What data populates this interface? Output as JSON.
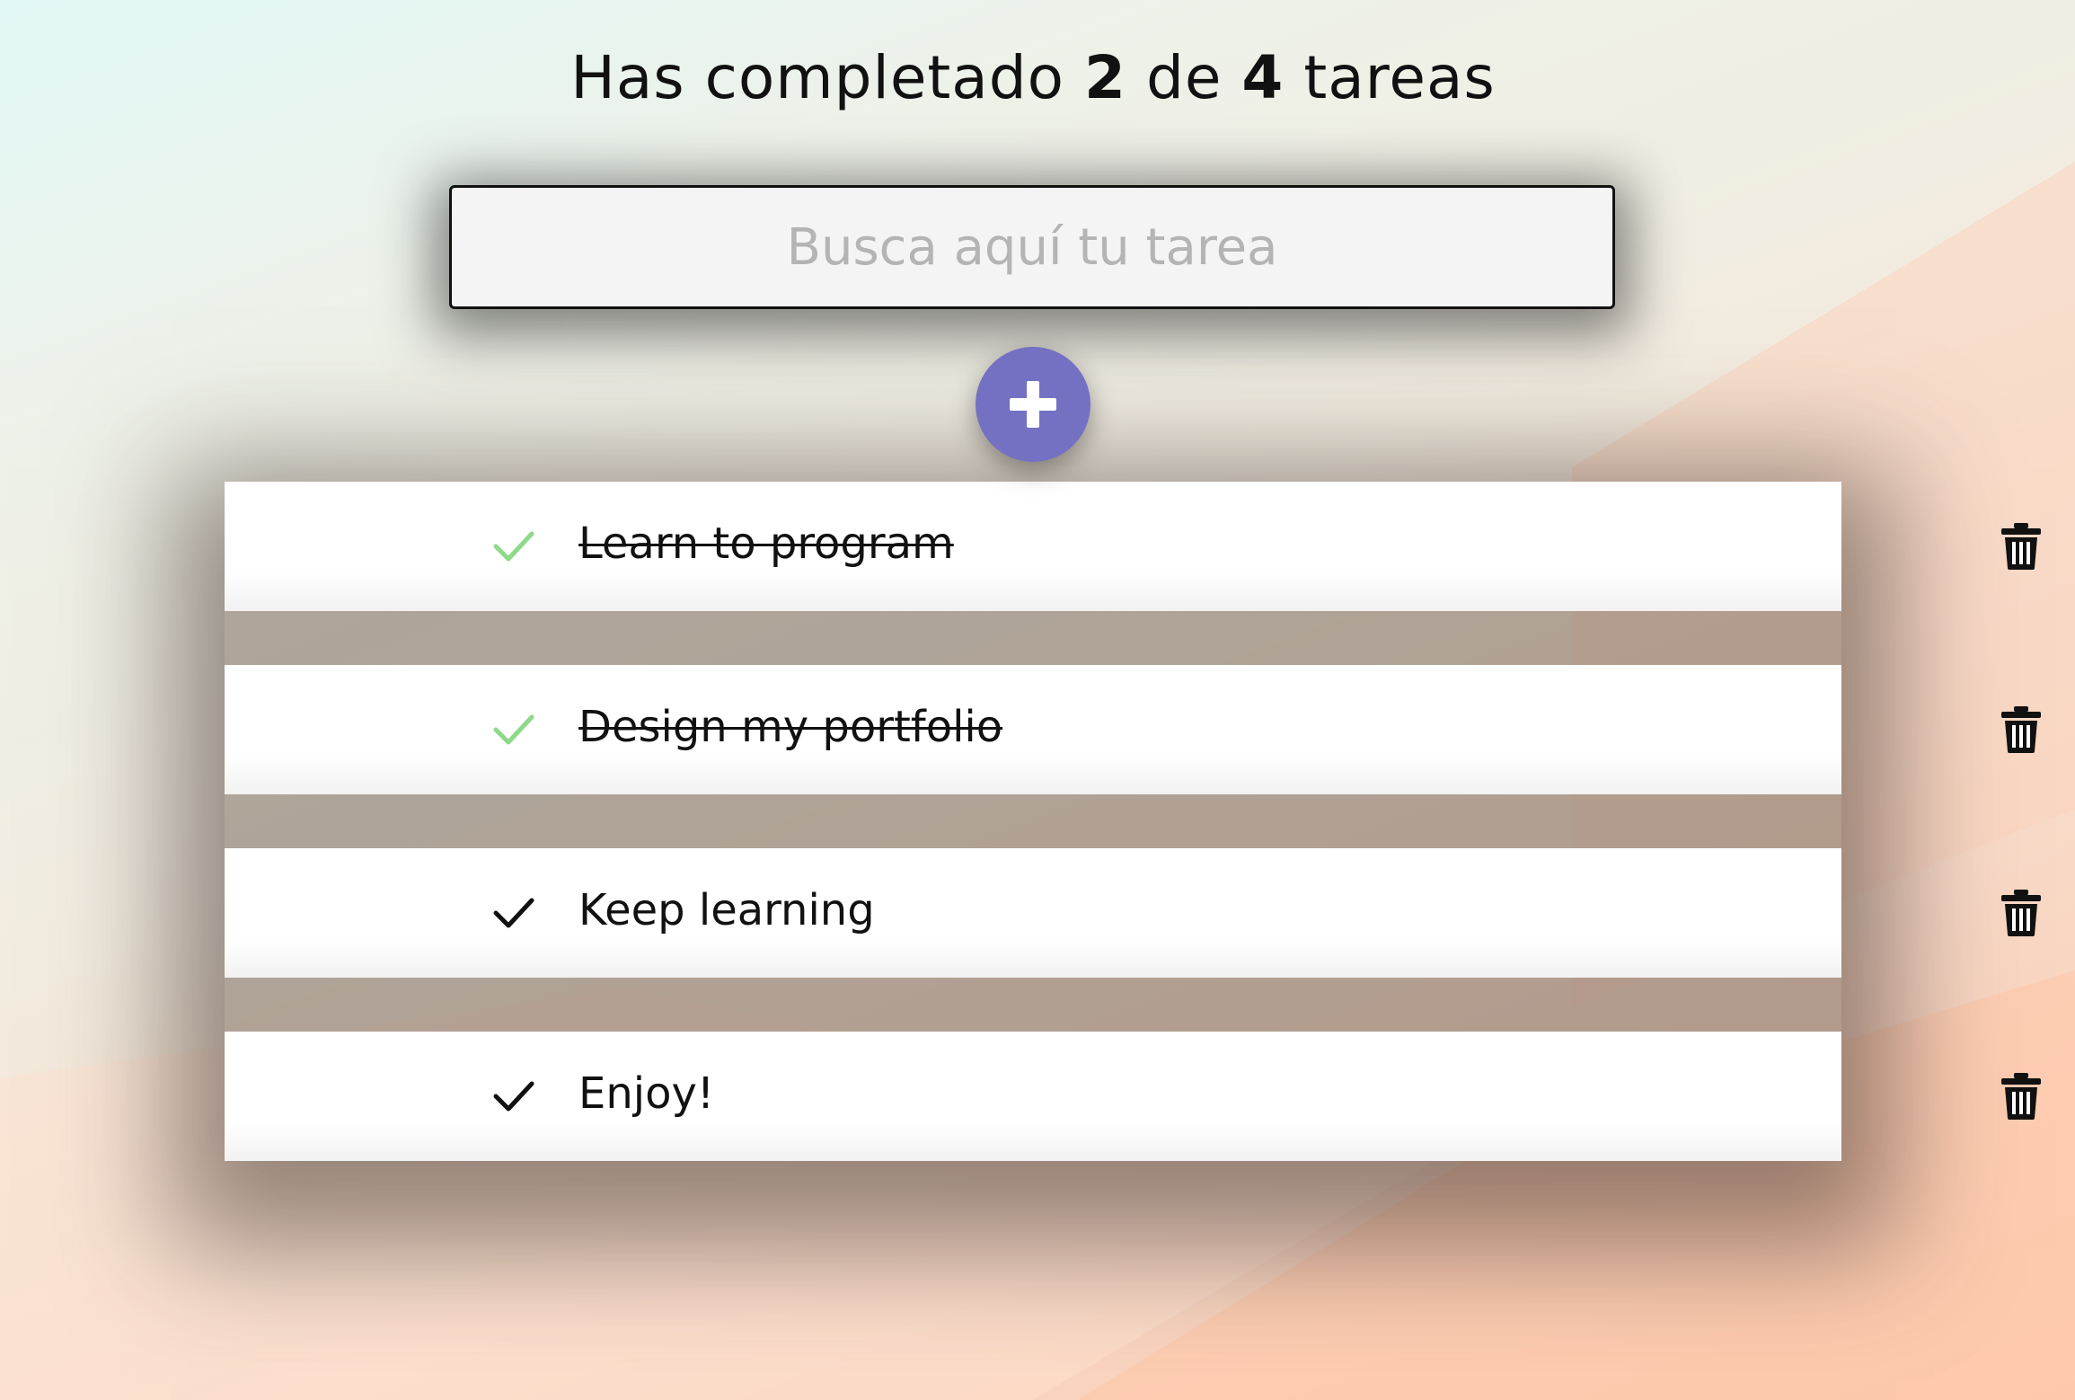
{
  "header": {
    "prefix": "Has completado",
    "completed": "2",
    "middle": "de",
    "total": "4",
    "suffix": "tareas"
  },
  "search": {
    "placeholder": "Busca aquí tu tarea",
    "value": ""
  },
  "add_button": {
    "icon": "plus-icon"
  },
  "todos": [
    {
      "text": "Learn to program",
      "completed": true
    },
    {
      "text": "Design my portfolio",
      "completed": true
    },
    {
      "text": "Keep learning",
      "completed": false
    },
    {
      "text": "Enjoy!",
      "completed": false
    }
  ],
  "colors": {
    "accent": "#7471c2",
    "check_completed": "#8fd98a",
    "check_pending": "#111111"
  },
  "icons": {
    "check": "check-icon",
    "delete": "trash-icon"
  }
}
